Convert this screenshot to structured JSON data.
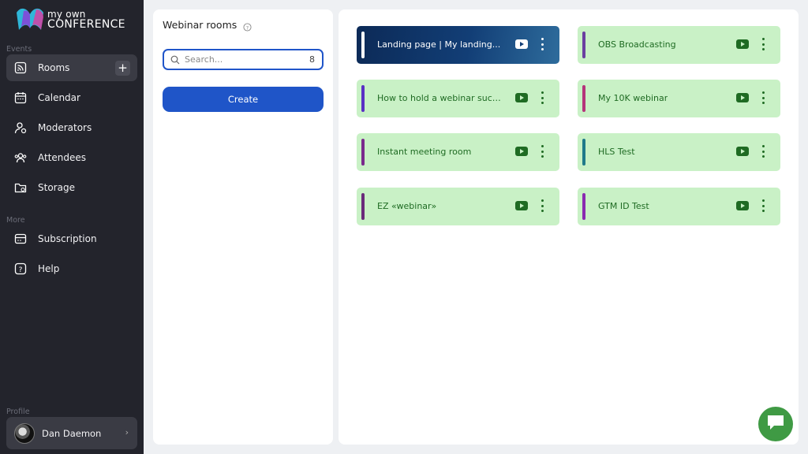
{
  "brand": {
    "line1": "my own",
    "line2": "CONFERENCE"
  },
  "sidebar": {
    "events_label": "Events",
    "more_label": "More",
    "profile_label": "Profile",
    "items": [
      {
        "label": "Rooms",
        "icon": "rss-icon",
        "active": true
      },
      {
        "label": "Calendar",
        "icon": "calendar-icon"
      },
      {
        "label": "Moderators",
        "icon": "moderator-icon"
      },
      {
        "label": "Attendees",
        "icon": "attendees-icon"
      },
      {
        "label": "Storage",
        "icon": "folder-icon"
      }
    ],
    "more_items": [
      {
        "label": "Subscription",
        "icon": "subscription-icon"
      },
      {
        "label": "Help",
        "icon": "help-icon"
      }
    ],
    "add_label": "+",
    "profile": {
      "name": "Dan Daemon"
    }
  },
  "left_panel": {
    "title": "Webinar rooms",
    "search_placeholder": "Search...",
    "count": "8",
    "create_label": "Create"
  },
  "rooms": [
    {
      "name": "Landing page  |  My landing...",
      "accent": "#ffffff",
      "featured": true
    },
    {
      "name": "OBS Broadcasting",
      "accent": "#6a3fa0"
    },
    {
      "name": "How to hold a webinar succ...",
      "accent": "#5a2fc4"
    },
    {
      "name": "My 10K webinar",
      "accent": "#b5347a"
    },
    {
      "name": "Instant meeting room",
      "accent": "#7a2a8c"
    },
    {
      "name": "HLS Test",
      "accent": "#1f7a8a"
    },
    {
      "name": "EZ «webinar»",
      "accent": "#6a2a7a"
    },
    {
      "name": "GTM ID Test",
      "accent": "#8a2ab0"
    }
  ],
  "colors": {
    "sidebar_bg": "#23242c",
    "primary": "#1f55c8",
    "room_bg": "#c9f1c6",
    "room_text": "#1f6b23",
    "chat": "#3f9a44"
  }
}
